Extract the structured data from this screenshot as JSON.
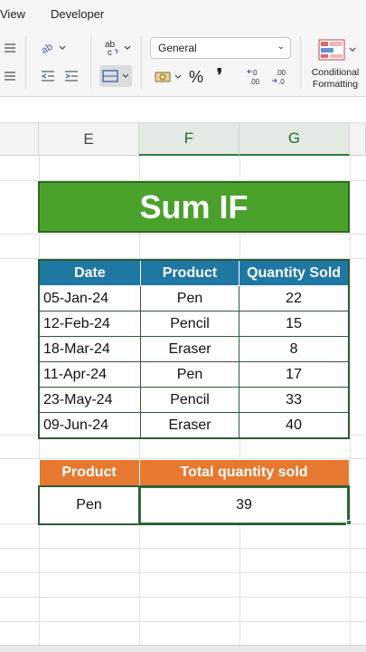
{
  "menu": {
    "items": [
      "View",
      "Developer"
    ]
  },
  "toolbar": {
    "number_format": "General",
    "conditional_formatting": [
      "Conditional",
      "Formatting"
    ],
    "percent_symbol": "%",
    "comma_symbol": "❜",
    "increase_decimal": "←0 .00",
    "decrease_decimal": ".00 →0"
  },
  "columns": [
    "E",
    "F",
    "G"
  ],
  "title": "Sum IF",
  "main_table": {
    "headers": [
      "Date",
      "Product",
      "Quantity Sold"
    ],
    "rows": [
      [
        "05-Jan-24",
        "Pen",
        "22"
      ],
      [
        "12-Feb-24",
        "Pencil",
        "15"
      ],
      [
        "18-Mar-24",
        "Eraser",
        "8"
      ],
      [
        "11-Apr-24",
        "Pen",
        "17"
      ],
      [
        "23-May-24",
        "Pencil",
        "33"
      ],
      [
        "09-Jun-24",
        "Eraser",
        "40"
      ]
    ]
  },
  "summary_table": {
    "headers": [
      "Product",
      "Total quantity sold"
    ],
    "product": "Pen",
    "total": "39"
  },
  "colors": {
    "title_bg": "#4aa22c",
    "main_header_bg": "#1f77a4",
    "summary_header_bg": "#e7782f",
    "selection": "#2e7d3e"
  }
}
